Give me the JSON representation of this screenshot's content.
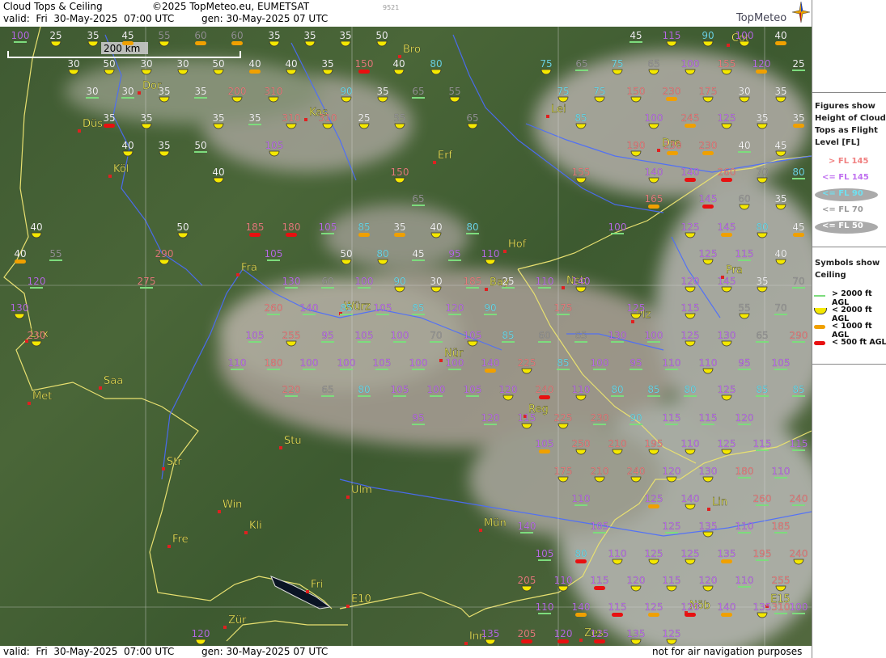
{
  "header": {
    "title": "Cloud Tops & Ceiling",
    "copyright": "©2025 TopMeteo.eu, EUMETSAT",
    "valid": "valid:  Fri  30-May-2025  07:00 UTC",
    "gen": "gen: 30-May-2025 07 UTC",
    "id": "9521",
    "logo": "TopMeteo"
  },
  "footer": {
    "valid": "valid:  Fri  30-May-2025  07:00 UTC",
    "gen": "gen: 30-May-2025 07 UTC",
    "note": "not for air navigation purposes"
  },
  "scale_label": "200 km",
  "legend": {
    "figures_title": [
      "Figures show",
      "Height of Cloud",
      "Tops as Flight",
      "Level  [FL]"
    ],
    "figure_items": [
      {
        "label": "> FL 145",
        "color": "#f08080"
      },
      {
        "label": "<= FL 145",
        "color": "#c070f0"
      },
      {
        "label": "<= FL 90",
        "color": "#70e0f0"
      },
      {
        "label": "<= FL 70",
        "color": "#9a9a9a"
      },
      {
        "label": "<= FL 50",
        "color": "#ffffff"
      }
    ],
    "symbols_title": [
      "Symbols show",
      "Ceiling"
    ],
    "symbol_items": [
      {
        "label": "> 2000 ft AGL",
        "symbol": "green-line"
      },
      {
        "label": "< 2000 ft AGL",
        "symbol": "yellow-half-disc"
      },
      {
        "label": "< 1000 ft AGL",
        "symbol": "orange-bar"
      },
      {
        "label": "< 500 ft AGL",
        "symbol": "red-bar"
      }
    ]
  },
  "cities": [
    "Bro",
    "Cot",
    "Dor",
    "Kas",
    "Düs",
    "Lei",
    "Erf",
    "Dre",
    "Köl",
    "Hof",
    "Fra",
    "Pra",
    "Bay",
    "Nsb",
    "Plz",
    "Lux",
    "Würz",
    "Nür",
    "Saa",
    "Met",
    "Reg",
    "Stu",
    "Str",
    "Ulm",
    "Win",
    "Kli",
    "Lin",
    "Fre",
    "Mün",
    "Fri",
    "E10",
    "Nöb",
    "E15",
    "Zür",
    "Inn",
    "Zes"
  ],
  "colors": {
    "fl_over_145": "#f08080",
    "fl_le_145": "#c070f0",
    "fl_le_90": "#70e0f0",
    "fl_le_70": "#9a9a9a",
    "fl_le_50": "#ffffff",
    "ceiling_green": "#7ddc7d",
    "ceiling_yellow": "#f4e800",
    "ceiling_orange": "#f0a000",
    "ceiling_red": "#e81010",
    "city_label": "#ffff60",
    "border": "#e8e070",
    "river": "#4a6cff"
  },
  "stations": [
    {
      "v": "100",
      "c": "g"
    },
    {
      "v": "25",
      "c": "y"
    },
    {
      "v": "35",
      "c": "y"
    },
    {
      "v": "45",
      "c": "o"
    },
    {
      "v": "55",
      "c": "y"
    },
    {
      "v": "60",
      "c": "o"
    },
    {
      "v": "60",
      "c": "o"
    },
    {
      "v": "35",
      "c": "y"
    },
    {
      "v": "35",
      "c": "y"
    },
    {
      "v": "35",
      "c": "y"
    },
    {
      "v": "50",
      "c": "y"
    },
    {
      "v": "45",
      "c": "g"
    },
    {
      "v": "115",
      "c": "y"
    },
    {
      "v": "90",
      "c": "y"
    },
    {
      "v": "100",
      "c": "y"
    },
    {
      "v": "40",
      "c": "o"
    },
    {
      "v": "30",
      "c": "y"
    },
    {
      "v": "50",
      "c": "y"
    },
    {
      "v": "30",
      "c": "y"
    },
    {
      "v": "30",
      "c": "y"
    },
    {
      "v": "50",
      "c": "y"
    },
    {
      "v": "40",
      "c": "o"
    },
    {
      "v": "40",
      "c": "y"
    },
    {
      "v": "35",
      "c": "y"
    },
    {
      "v": "150",
      "c": "r"
    },
    {
      "v": "40",
      "c": "y"
    },
    {
      "v": "80",
      "c": "y"
    },
    {
      "v": "75",
      "c": "y"
    },
    {
      "v": "65",
      "c": "g"
    },
    {
      "v": "75",
      "c": "y"
    },
    {
      "v": "65",
      "c": "y"
    },
    {
      "v": "100",
      "c": "y"
    },
    {
      "v": "155",
      "c": "y"
    },
    {
      "v": "120",
      "c": "o"
    },
    {
      "v": "25",
      "c": "g"
    },
    {
      "v": "30",
      "c": "g"
    },
    {
      "v": "30",
      "c": "g"
    },
    {
      "v": "35",
      "c": "y"
    },
    {
      "v": "35",
      "c": "g"
    },
    {
      "v": "200",
      "c": "y"
    },
    {
      "v": "310",
      "c": "y"
    },
    {
      "v": "90",
      "c": "y"
    },
    {
      "v": "35",
      "c": "y"
    },
    {
      "v": "65",
      "c": "g"
    },
    {
      "v": "55",
      "c": "y"
    },
    {
      "v": "75",
      "c": "y"
    },
    {
      "v": "75",
      "c": "y"
    },
    {
      "v": "150",
      "c": "y"
    },
    {
      "v": "230",
      "c": "o"
    },
    {
      "v": "175",
      "c": "y"
    },
    {
      "v": "30",
      "c": "y"
    },
    {
      "v": "35",
      "c": "y"
    },
    {
      "v": "35",
      "c": "r"
    },
    {
      "v": "35",
      "c": "y"
    },
    {
      "v": "35",
      "c": "y"
    },
    {
      "v": "35",
      "c": "g"
    },
    {
      "v": "310",
      "c": "y"
    },
    {
      "v": "310",
      "c": "y"
    },
    {
      "v": "25",
      "c": "y"
    },
    {
      "v": "55",
      "c": "y"
    },
    {
      "v": "65",
      "c": "y"
    },
    {
      "v": "85",
      "c": "y"
    },
    {
      "v": "100",
      "c": "y"
    },
    {
      "v": "245",
      "c": "o"
    },
    {
      "v": "125",
      "c": "y"
    },
    {
      "v": "35",
      "c": "y"
    },
    {
      "v": "35",
      "c": "o"
    },
    {
      "v": "40",
      "c": "y"
    },
    {
      "v": "35",
      "c": "y"
    },
    {
      "v": "50",
      "c": "g"
    },
    {
      "v": "105",
      "c": "y"
    },
    {
      "v": "190",
      "c": "y"
    },
    {
      "v": "230",
      "c": "o"
    },
    {
      "v": "230",
      "c": "o"
    },
    {
      "v": "40",
      "c": "g"
    },
    {
      "v": "45",
      "c": "y"
    },
    {
      "v": "40",
      "c": "y"
    },
    {
      "v": "150",
      "c": "y"
    },
    {
      "v": "155",
      "c": "y"
    },
    {
      "v": "140",
      "c": "y"
    },
    {
      "v": "140",
      "c": "r"
    },
    {
      "v": "260",
      "c": "r"
    },
    {
      "v": "70",
      "c": "y"
    },
    {
      "v": "80",
      "c": "g"
    },
    {
      "v": "65",
      "c": "g"
    },
    {
      "v": "165",
      "c": "o"
    },
    {
      "v": "145",
      "c": "r"
    },
    {
      "v": "60",
      "c": "y"
    },
    {
      "v": "35",
      "c": "y"
    },
    {
      "v": "40",
      "c": "y"
    },
    {
      "v": "50",
      "c": "y"
    },
    {
      "v": "185",
      "c": "r"
    },
    {
      "v": "180",
      "c": "r"
    },
    {
      "v": "105",
      "c": "g"
    },
    {
      "v": "85",
      "c": "o"
    },
    {
      "v": "35",
      "c": "o"
    },
    {
      "v": "40",
      "c": "y"
    },
    {
      "v": "80",
      "c": "g"
    },
    {
      "v": "100",
      "c": "g"
    },
    {
      "v": "125",
      "c": "y"
    },
    {
      "v": "145",
      "c": "o"
    },
    {
      "v": "80",
      "c": "y"
    },
    {
      "v": "45",
      "c": "o"
    },
    {
      "v": "40",
      "c": "o"
    },
    {
      "v": "55",
      "c": "g"
    },
    {
      "v": "290",
      "c": "y"
    },
    {
      "v": "105",
      "c": "g"
    },
    {
      "v": "50",
      "c": "y"
    },
    {
      "v": "80",
      "c": "y"
    },
    {
      "v": "45",
      "c": "g"
    },
    {
      "v": "95",
      "c": "g"
    },
    {
      "v": "110",
      "c": "y"
    },
    {
      "v": "125",
      "c": "y"
    },
    {
      "v": "115",
      "c": "g"
    },
    {
      "v": "40",
      "c": "y"
    },
    {
      "v": "120",
      "c": "g"
    },
    {
      "v": "275",
      "c": "g"
    },
    {
      "v": "130",
      "c": "g"
    },
    {
      "v": "60",
      "c": "g"
    },
    {
      "v": "100",
      "c": "g"
    },
    {
      "v": "90",
      "c": "y"
    },
    {
      "v": "30",
      "c": "y"
    },
    {
      "v": "185",
      "c": "g"
    },
    {
      "v": "25",
      "c": "g"
    },
    {
      "v": "110",
      "c": "g"
    },
    {
      "v": "140",
      "c": "y"
    },
    {
      "v": "120",
      "c": "y"
    },
    {
      "v": "145",
      "c": "y"
    },
    {
      "v": "35",
      "c": "y"
    },
    {
      "v": "70",
      "c": "g"
    },
    {
      "v": "130",
      "c": "y"
    },
    {
      "v": "260",
      "c": "g"
    },
    {
      "v": "140",
      "c": "g"
    },
    {
      "v": "85",
      "c": "g"
    },
    {
      "v": "105",
      "c": "g"
    },
    {
      "v": "85",
      "c": "g"
    },
    {
      "v": "120",
      "c": "g"
    },
    {
      "v": "90",
      "c": "g"
    },
    {
      "v": "175",
      "c": "g"
    },
    {
      "v": "125",
      "c": "y"
    },
    {
      "v": "115",
      "c": "y"
    },
    {
      "v": "55",
      "c": "y"
    },
    {
      "v": "70",
      "c": "g"
    },
    {
      "v": "230",
      "c": "y"
    },
    {
      "v": "105",
      "c": "g"
    },
    {
      "v": "255",
      "c": "y"
    },
    {
      "v": "95",
      "c": "g"
    },
    {
      "v": "105",
      "c": "g"
    },
    {
      "v": "100",
      "c": "g"
    },
    {
      "v": "70",
      "c": "g"
    },
    {
      "v": "105",
      "c": "y"
    },
    {
      "v": "85",
      "c": "g"
    },
    {
      "v": "60",
      "c": "g"
    },
    {
      "v": "65",
      "c": "g"
    },
    {
      "v": "130",
      "c": "g"
    },
    {
      "v": "100",
      "c": "g"
    },
    {
      "v": "125",
      "c": "y"
    },
    {
      "v": "130",
      "c": "y"
    },
    {
      "v": "65",
      "c": "g"
    },
    {
      "v": "290",
      "c": "g"
    },
    {
      "v": "110",
      "c": "g"
    },
    {
      "v": "180",
      "c": "g"
    },
    {
      "v": "100",
      "c": "g"
    },
    {
      "v": "100",
      "c": "g"
    },
    {
      "v": "105",
      "c": "g"
    },
    {
      "v": "100",
      "c": "g"
    },
    {
      "v": "100",
      "c": "g"
    },
    {
      "v": "140",
      "c": "o"
    },
    {
      "v": "225",
      "c": "y"
    },
    {
      "v": "85",
      "c": "g"
    },
    {
      "v": "100",
      "c": "g"
    },
    {
      "v": "95",
      "c": "g"
    },
    {
      "v": "110",
      "c": "g"
    },
    {
      "v": "110",
      "c": "y"
    },
    {
      "v": "95",
      "c": "g"
    },
    {
      "v": "105",
      "c": "g"
    },
    {
      "v": "220",
      "c": "g"
    },
    {
      "v": "65",
      "c": "g"
    },
    {
      "v": "80",
      "c": "g"
    },
    {
      "v": "105",
      "c": "g"
    },
    {
      "v": "100",
      "c": "g"
    },
    {
      "v": "105",
      "c": "g"
    },
    {
      "v": "120",
      "c": "y"
    },
    {
      "v": "240",
      "c": "r"
    },
    {
      "v": "110",
      "c": "y"
    },
    {
      "v": "80",
      "c": "g"
    },
    {
      "v": "85",
      "c": "g"
    },
    {
      "v": "80",
      "c": "g"
    },
    {
      "v": "125",
      "c": "y"
    },
    {
      "v": "85",
      "c": "g"
    },
    {
      "v": "85",
      "c": "g"
    },
    {
      "v": "95",
      "c": "g"
    },
    {
      "v": "120",
      "c": "g"
    },
    {
      "v": "115",
      "c": "y"
    },
    {
      "v": "225",
      "c": "y"
    },
    {
      "v": "230",
      "c": "g"
    },
    {
      "v": "90",
      "c": "g"
    },
    {
      "v": "115",
      "c": "g"
    },
    {
      "v": "115",
      "c": "g"
    },
    {
      "v": "120",
      "c": "g"
    },
    {
      "v": "105",
      "c": "o"
    },
    {
      "v": "250",
      "c": "y"
    },
    {
      "v": "210",
      "c": "y"
    },
    {
      "v": "195",
      "c": "y"
    },
    {
      "v": "110",
      "c": "y"
    },
    {
      "v": "125",
      "c": "y"
    },
    {
      "v": "115",
      "c": "g"
    },
    {
      "v": "115",
      "c": "g"
    },
    {
      "v": "175",
      "c": "y"
    },
    {
      "v": "210",
      "c": "y"
    },
    {
      "v": "240",
      "c": "y"
    },
    {
      "v": "120",
      "c": "y"
    },
    {
      "v": "130",
      "c": "y"
    },
    {
      "v": "180",
      "c": "g"
    },
    {
      "v": "110",
      "c": "g"
    },
    {
      "v": "110",
      "c": "g"
    },
    {
      "v": "125",
      "c": "o"
    },
    {
      "v": "140",
      "c": "y"
    },
    {
      "v": "260",
      "c": "g"
    },
    {
      "v": "240",
      "c": "g"
    },
    {
      "v": "140",
      "c": "g"
    },
    {
      "v": "105",
      "c": "g"
    },
    {
      "v": "125",
      "c": "g"
    },
    {
      "v": "135",
      "c": "y"
    },
    {
      "v": "110",
      "c": "g"
    },
    {
      "v": "185",
      "c": "g"
    },
    {
      "v": "105",
      "c": "g"
    },
    {
      "v": "80",
      "c": "r"
    },
    {
      "v": "110",
      "c": "y"
    },
    {
      "v": "125",
      "c": "y"
    },
    {
      "v": "125",
      "c": "y"
    },
    {
      "v": "135",
      "c": "o"
    },
    {
      "v": "195",
      "c": "g"
    },
    {
      "v": "240",
      "c": "y"
    },
    {
      "v": "205",
      "c": "y"
    },
    {
      "v": "110",
      "c": "y"
    },
    {
      "v": "115",
      "c": "r"
    },
    {
      "v": "120",
      "c": "y"
    },
    {
      "v": "115",
      "c": "y"
    },
    {
      "v": "120",
      "c": "y"
    },
    {
      "v": "110",
      "c": "g"
    },
    {
      "v": "255",
      "c": "y"
    },
    {
      "v": "110",
      "c": "g"
    },
    {
      "v": "140",
      "c": "o"
    },
    {
      "v": "115",
      "c": "r"
    },
    {
      "v": "125",
      "c": "o"
    },
    {
      "v": "120",
      "c": "r"
    },
    {
      "v": "140",
      "c": "o"
    },
    {
      "v": "135",
      "c": "y"
    },
    {
      "v": "310",
      "c": "g"
    },
    {
      "v": "100",
      "c": "g"
    },
    {
      "v": "120",
      "c": "y"
    },
    {
      "v": "135",
      "c": "y"
    },
    {
      "v": "205",
      "c": "r"
    },
    {
      "v": "120",
      "c": "r"
    },
    {
      "v": "125",
      "c": "r"
    },
    {
      "v": "135",
      "c": "y"
    },
    {
      "v": "125",
      "c": "y"
    }
  ]
}
